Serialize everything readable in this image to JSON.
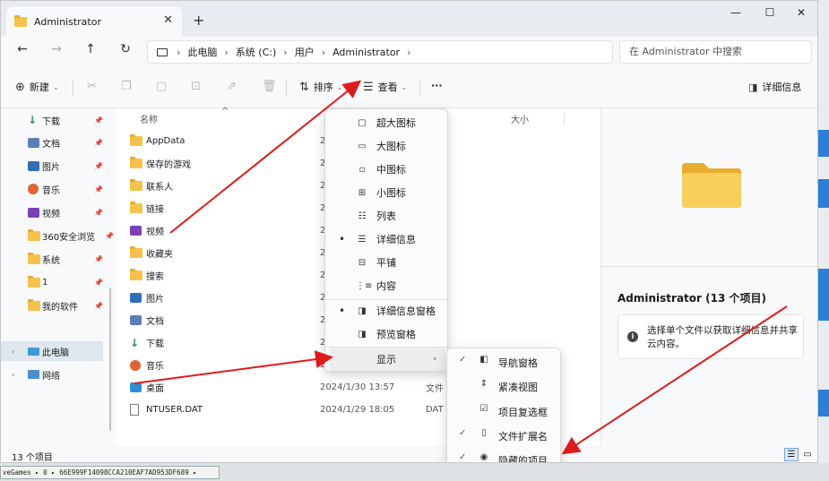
{
  "window": {
    "tab_title": "Administrator",
    "new_tab": "+",
    "close_tab": "✕",
    "minimize": "—",
    "maximize": "☐",
    "close": "✕"
  },
  "nav": {
    "back": "←",
    "forward": "→",
    "up": "↑",
    "refresh": "↻",
    "breadcrumb": [
      "此电脑",
      "系统 (C:)",
      "用户",
      "Administrator"
    ],
    "search_placeholder": "在 Administrator 中搜索"
  },
  "toolbar": {
    "new": "新建",
    "sort": "排序",
    "view": "查看",
    "more": "···",
    "details": "详细信息"
  },
  "sidebar": {
    "quick": [
      {
        "label": "下载",
        "icon": "download-icon"
      },
      {
        "label": "文档",
        "icon": "document-icon"
      },
      {
        "label": "图片",
        "icon": "pictures-icon"
      },
      {
        "label": "音乐",
        "icon": "music-icon"
      },
      {
        "label": "视频",
        "icon": "video-icon"
      },
      {
        "label": "360安全浏览",
        "icon": "folder-icon"
      },
      {
        "label": "系统",
        "icon": "folder-icon"
      },
      {
        "label": "1",
        "icon": "folder-icon"
      },
      {
        "label": "我的软件",
        "icon": "folder-icon"
      }
    ],
    "this_pc": "此电脑",
    "network": "网络"
  },
  "filelist": {
    "col_name": "名称",
    "col_size": "大小",
    "rows": [
      {
        "name": "AppData",
        "date": "2",
        "type": ""
      },
      {
        "name": "保存的游戏",
        "date": "2",
        "type": ""
      },
      {
        "name": "联系人",
        "date": "2",
        "type": ""
      },
      {
        "name": "链接",
        "date": "2",
        "type": ""
      },
      {
        "name": "视频",
        "date": "2",
        "type": ""
      },
      {
        "name": "收藏夹",
        "date": "2",
        "type": ""
      },
      {
        "name": "搜索",
        "date": "2",
        "type": ""
      },
      {
        "name": "图片",
        "date": "2",
        "type": ""
      },
      {
        "name": "文档",
        "date": "2",
        "type": ""
      },
      {
        "name": "下载",
        "date": "2",
        "type": ""
      },
      {
        "name": "音乐",
        "date": "2",
        "type": ""
      },
      {
        "name": "桌面",
        "date": "2024/1/30 13:57",
        "type": "文件"
      },
      {
        "name": "NTUSER.DAT",
        "date": "2024/1/29 18:05",
        "type": "DAT"
      }
    ]
  },
  "details_pane": {
    "title": "Administrator (13 个项目)",
    "hint": "选择单个文件以获取详细信息并共享云内容。"
  },
  "status": {
    "count": "13 个项目"
  },
  "view_menu": {
    "items": [
      {
        "label": "超大图标",
        "icon": "monitor-icon",
        "selected": false
      },
      {
        "label": "大图标",
        "icon": "monitor-icon",
        "selected": false
      },
      {
        "label": "中图标",
        "icon": "monitor-icon",
        "selected": false
      },
      {
        "label": "小图标",
        "icon": "grid-icon",
        "selected": false
      },
      {
        "label": "列表",
        "icon": "list-icon",
        "selected": false
      },
      {
        "label": "详细信息",
        "icon": "details-icon",
        "selected": true
      },
      {
        "label": "平铺",
        "icon": "tiles-icon",
        "selected": false
      },
      {
        "label": "内容",
        "icon": "content-icon",
        "selected": false
      },
      {
        "label": "详细信息窗格",
        "icon": "pane-icon",
        "selected": true
      },
      {
        "label": "预览窗格",
        "icon": "pane-icon",
        "selected": false
      }
    ],
    "show": "显示"
  },
  "show_submenu": {
    "items": [
      {
        "label": "导航窗格",
        "checked": true
      },
      {
        "label": "紧凑视图",
        "checked": false
      },
      {
        "label": "项目复选框",
        "checked": false
      },
      {
        "label": "文件扩展名",
        "checked": true
      },
      {
        "label": "隐藏的项目",
        "checked": true
      }
    ]
  },
  "background": {
    "bottom_path": "veGames ▸ 0 ▸ 66E999F14098CCA210EAF7AD953DF689 ▸"
  },
  "colors": {
    "folder": "#f5c34c",
    "accent": "#2a7fd6",
    "arrow": "#e01b1b"
  }
}
